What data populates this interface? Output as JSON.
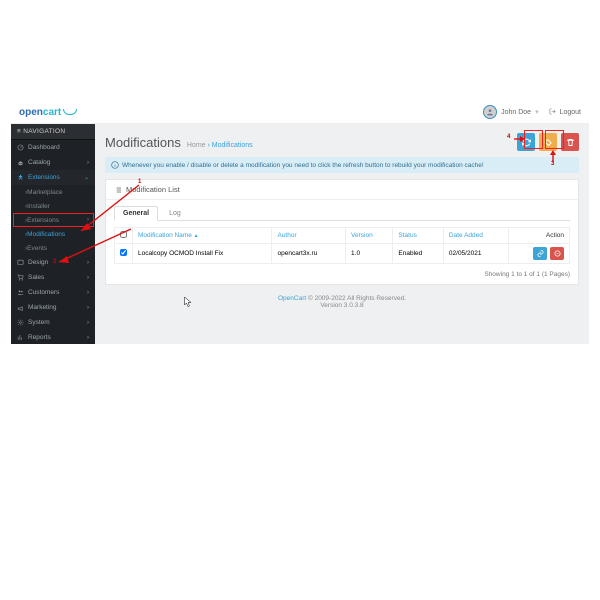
{
  "header": {
    "logo_a": "open",
    "logo_b": "cart",
    "user": "John Doe",
    "logout": "Logout"
  },
  "sidebar": {
    "title": "NAVIGATION",
    "items": [
      {
        "label": "Dashboard"
      },
      {
        "label": "Catalog"
      },
      {
        "label": "Extensions"
      },
      {
        "label": "Design"
      },
      {
        "label": "Sales"
      },
      {
        "label": "Customers"
      },
      {
        "label": "Marketing"
      },
      {
        "label": "System"
      },
      {
        "label": "Reports"
      }
    ],
    "subs": [
      {
        "label": "Marketplace"
      },
      {
        "label": "Installer"
      },
      {
        "label": "Extensions"
      },
      {
        "label": "Modifications"
      },
      {
        "label": "Events"
      }
    ]
  },
  "page": {
    "title": "Modifications",
    "crumb_home": "Home",
    "crumb_here": "Modifications",
    "alert": "Whenever you enable / disable or delete a modification you need to click the refresh button to rebuild your modification cache!"
  },
  "panel": {
    "title": "Modification List",
    "tab_general": "General",
    "tab_log": "Log",
    "cols": {
      "name": "Modification Name",
      "author": "Author",
      "version": "Version",
      "status": "Status",
      "date": "Date Added",
      "action": "Action"
    },
    "row": {
      "name": "Localcopy OCMOD Install Fix",
      "author": "opencart3x.ru",
      "version": "1.0",
      "status": "Enabled",
      "date": "02/05/2021"
    },
    "pager": "Showing 1 to 1 of 1 (1 Pages)"
  },
  "footer": {
    "link": "OpenCart",
    "copy": " © 2009-2022 All Rights Reserved.",
    "ver": "Version 3.0.3.8"
  },
  "annot": {
    "n1": "1",
    "n2": "2",
    "n3": "3",
    "n4": "4"
  }
}
